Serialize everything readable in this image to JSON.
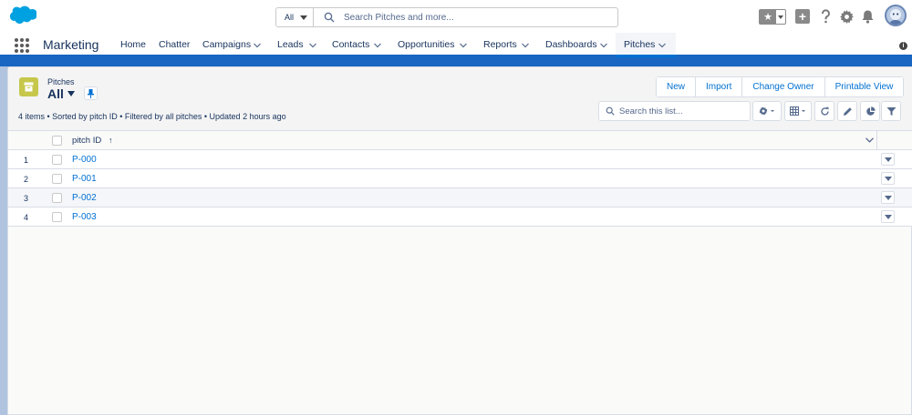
{
  "search": {
    "scope": "All",
    "placeholder": "Search Pitches and more..."
  },
  "app": {
    "name": "Marketing"
  },
  "nav": {
    "items": [
      {
        "label": "Home",
        "dropdown": false
      },
      {
        "label": "Chatter",
        "dropdown": false
      },
      {
        "label": "Campaigns",
        "dropdown": true
      },
      {
        "label": "Leads",
        "dropdown": true
      },
      {
        "label": "Contacts",
        "dropdown": true
      },
      {
        "label": "Opportunities",
        "dropdown": true
      },
      {
        "label": "Reports",
        "dropdown": true
      },
      {
        "label": "Dashboards",
        "dropdown": true
      },
      {
        "label": "Pitches",
        "dropdown": true,
        "active": true
      }
    ]
  },
  "list": {
    "object_label": "Pitches",
    "view_name": "All",
    "summary": "4 items • Sorted by pitch ID • Filtered by all pitches • Updated 2 hours ago",
    "buttons": [
      "New",
      "Import",
      "Change Owner",
      "Printable View"
    ],
    "search_placeholder": "Search this list...",
    "column_header": "pitch ID",
    "sort_indicator": "↑",
    "rows": [
      {
        "num": "1",
        "pitch_id": "P-000"
      },
      {
        "num": "2",
        "pitch_id": "P-001"
      },
      {
        "num": "3",
        "pitch_id": "P-002"
      },
      {
        "num": "4",
        "pitch_id": "P-003"
      }
    ]
  },
  "colors": {
    "brand_blue": "#1865c2",
    "link_blue": "#0070d2",
    "object_icon": "#c6c74b",
    "text": "#16325c"
  },
  "icons": {
    "header": [
      "favorites-star-icon",
      "add-icon",
      "help-icon",
      "setup-gear-icon",
      "notifications-bell-icon",
      "user-avatar"
    ],
    "list_tools": [
      "settings-gear-icon",
      "table-view-icon",
      "refresh-icon",
      "edit-pencil-icon",
      "chart-icon",
      "filter-icon"
    ]
  }
}
